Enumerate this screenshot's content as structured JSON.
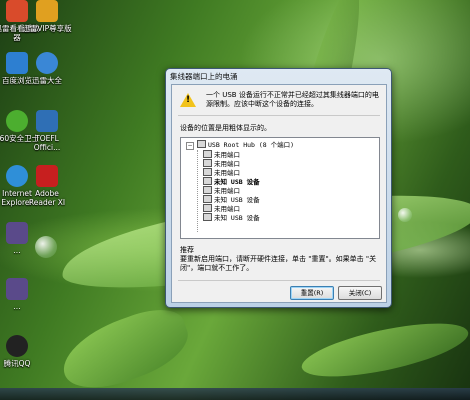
{
  "desktop_icons": [
    {
      "label": "迅雷看看播放器",
      "color": "#d94b2b"
    },
    {
      "label": "迅雷VIP尊享版",
      "color": "#e0a020"
    },
    {
      "label": "百度浏览",
      "color": "#2d7fd1"
    },
    {
      "label": "迅雷大全",
      "color": "#3a87d6"
    },
    {
      "label": "360安全卫士",
      "color": "#4cae2f"
    },
    {
      "label": "TOEFL Offici...",
      "color": "#2f6fb5"
    },
    {
      "label": "Internet Explorer",
      "color": "#2f8fd8"
    },
    {
      "label": "Adobe Reader XI",
      "color": "#c71f1f"
    },
    {
      "label": "...",
      "color": "#5a4a8a"
    },
    {
      "label": "...",
      "color": "#5a4a8a"
    },
    {
      "label": "腾讯QQ",
      "color": "#222222"
    }
  ],
  "dialog": {
    "title": "集线器端口上的电涌",
    "message": "一个 USB 设备运行不正常并已经超过其集线器端口的电源限制。应该中断这个设备的连接。",
    "tree_label": "设备的位置是用粗体显示的。",
    "tree": {
      "root": "USB Root Hub (8 个端口)",
      "nodes": [
        {
          "label": "未用端口",
          "bold": false
        },
        {
          "label": "未用端口",
          "bold": false
        },
        {
          "label": "未用端口",
          "bold": false
        },
        {
          "label": "未知 USB 设备",
          "bold": true
        },
        {
          "label": "未用端口",
          "bold": false
        },
        {
          "label": "未知 USB 设备",
          "bold": false
        },
        {
          "label": "未用端口",
          "bold": false
        },
        {
          "label": "未知 USB 设备",
          "bold": false
        }
      ]
    },
    "hint_title": "推荐",
    "hint": "要重新启用端口，请断开硬件连接，单击 \"重置\"。如果单击 \"关闭\"，端口就不工作了。",
    "buttons": {
      "reset": "重置(R)",
      "close": "关闭(C)"
    }
  },
  "colors": {
    "warning": "#f2c31b",
    "window_border": "#3d5873",
    "default_button_border": "#3c7fb1"
  }
}
